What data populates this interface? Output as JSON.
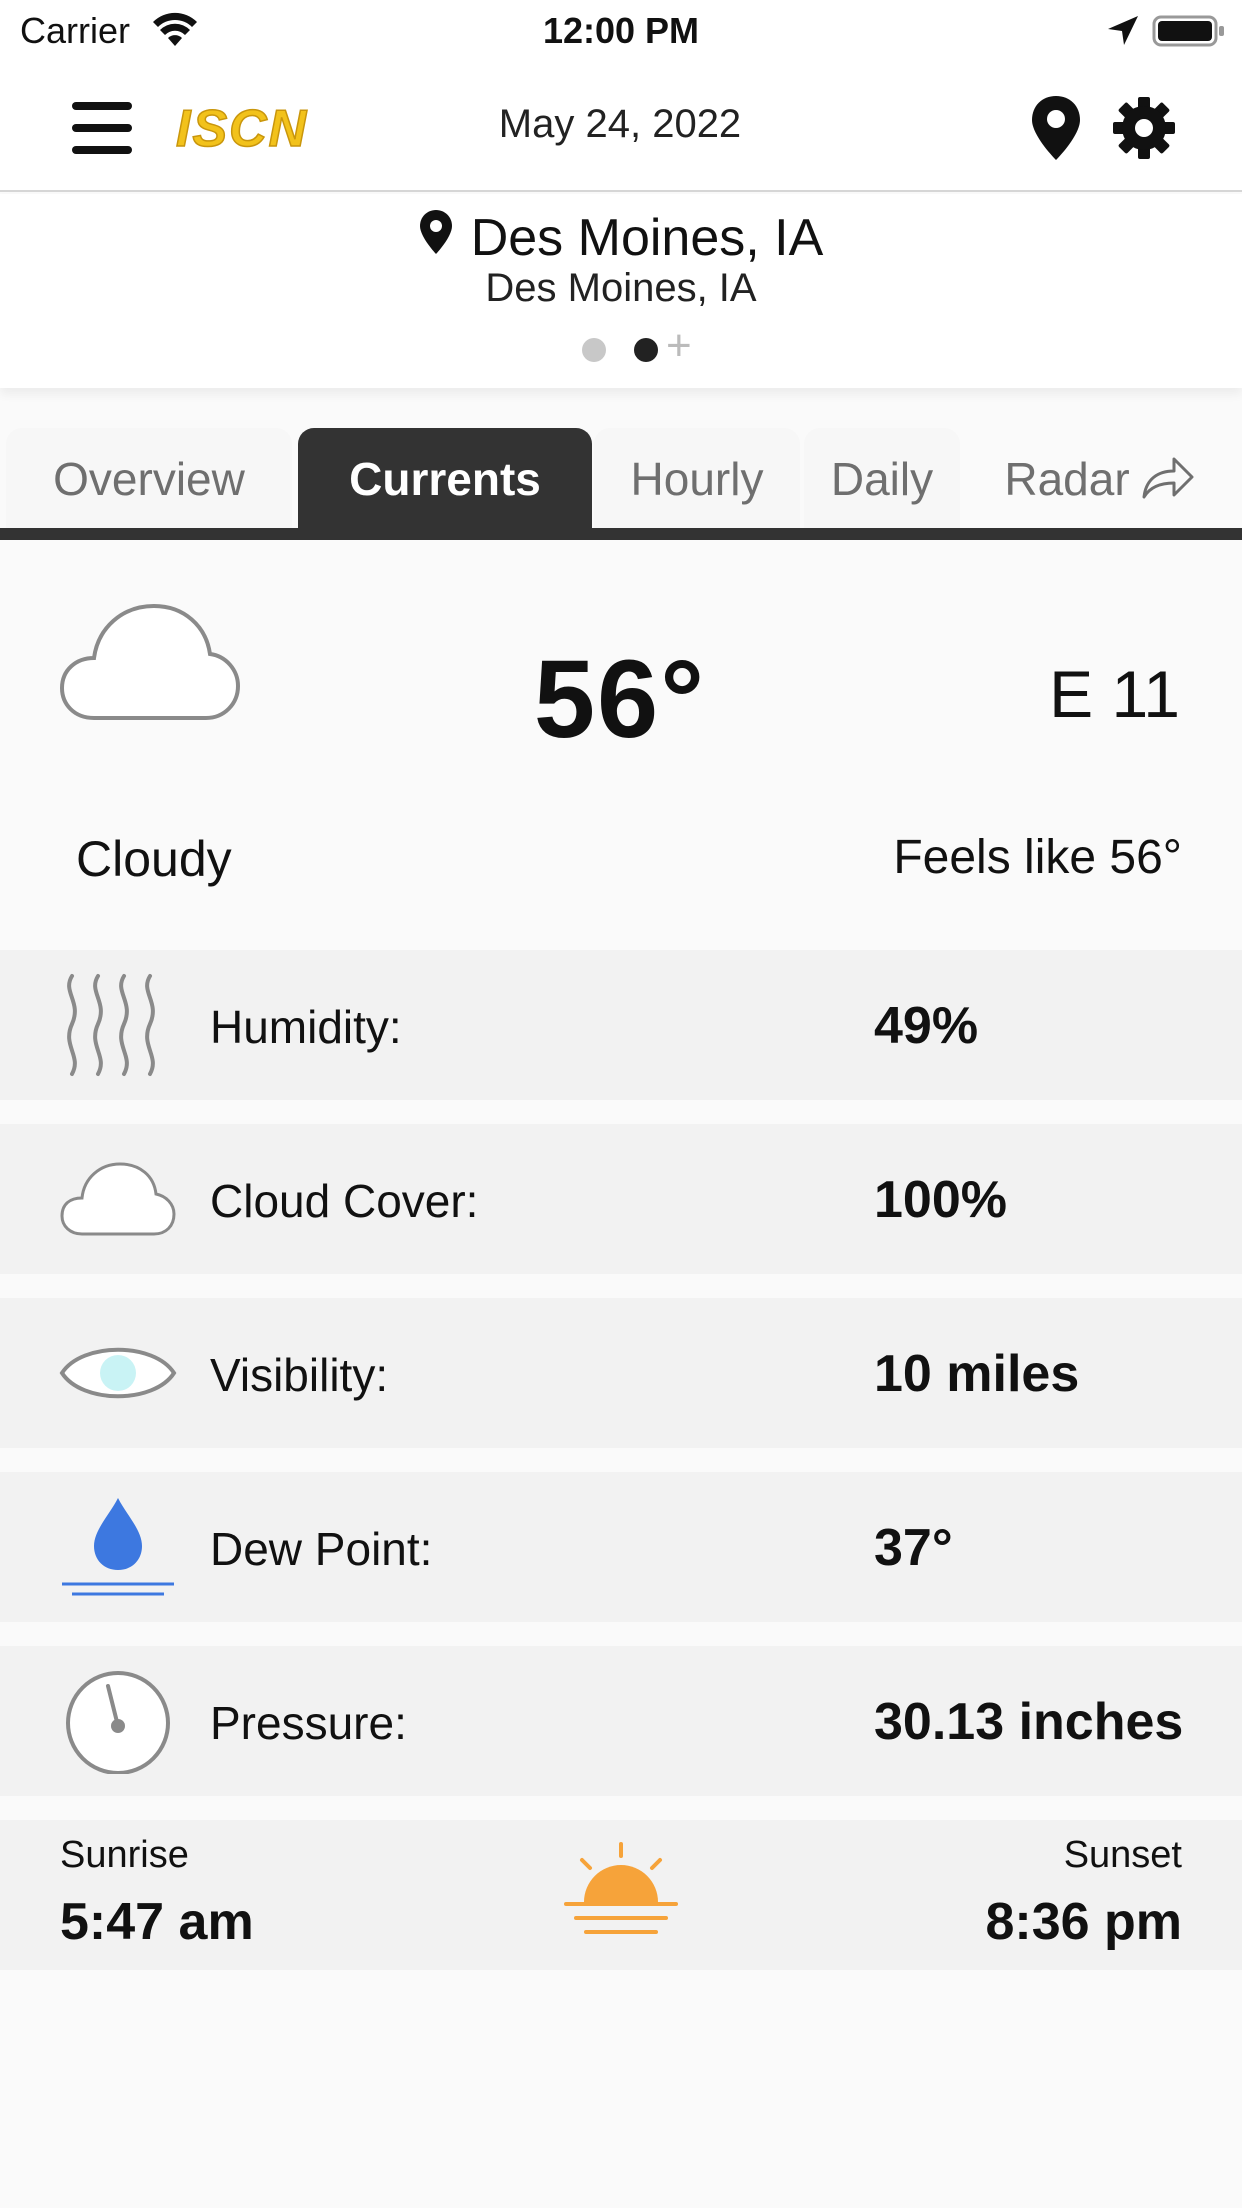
{
  "status_bar": {
    "carrier": "Carrier",
    "time": "12:00 PM"
  },
  "nav": {
    "logo_text": "ISCN",
    "date": "May 24, 2022",
    "icons": [
      "menu-icon",
      "location-pin-icon",
      "gear-icon"
    ]
  },
  "location": {
    "title": "Des Moines, IA",
    "subtitle": "Des Moines, IA",
    "pager_active_index": 1,
    "pager_count": 2
  },
  "tabs": [
    {
      "label": "Overview",
      "active": false
    },
    {
      "label": "Currents",
      "active": true
    },
    {
      "label": "Hourly",
      "active": false
    },
    {
      "label": "Daily",
      "active": false
    },
    {
      "label": "Radar",
      "active": false
    }
  ],
  "current": {
    "temperature": "56°",
    "wind": "E 11",
    "condition": "Cloudy",
    "feels_like": "Feels like 56°",
    "icon": "cloud-icon"
  },
  "details": [
    {
      "label": "Humidity:",
      "value": "49%",
      "icon": "humidity-icon"
    },
    {
      "label": "Cloud Cover:",
      "value": "100%",
      "icon": "cloud-cover-icon"
    },
    {
      "label": "Visibility:",
      "value": "10 miles",
      "icon": "eye-icon"
    },
    {
      "label": "Dew Point:",
      "value": "37°",
      "icon": "dew-drop-icon"
    },
    {
      "label": "Pressure:",
      "value": "30.13 inches",
      "icon": "gauge-icon"
    }
  ],
  "sun": {
    "sunrise_label": "Sunrise",
    "sunrise_time": "5:47 am",
    "sunset_label": "Sunset",
    "sunset_time": "8:36 pm"
  },
  "colors": {
    "logo_gold": "#f2c21b",
    "active_tab": "#333333",
    "dew_blue": "#3d78e0",
    "sun_orange": "#f6a33a",
    "eye_cyan": "#c9f3f5"
  }
}
